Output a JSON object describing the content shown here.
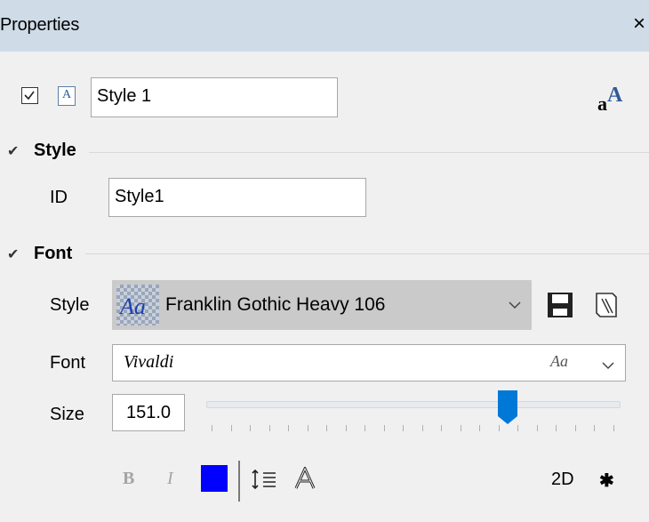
{
  "window": {
    "title": "Properties",
    "close_glyph": "×"
  },
  "header": {
    "enabled": true,
    "checkbox_icon": "checkbox-checked-icon",
    "doc_icon_glyph": "A",
    "style_name_value": "Style 1",
    "font_settings_icon": "font-size-icon"
  },
  "sections": {
    "style": {
      "label": "Style",
      "id_label": "ID",
      "id_value": "Style1"
    },
    "font": {
      "label": "Font",
      "style_label": "Style",
      "style_value": "Franklin Gothic Heavy 106",
      "font_label": "Font",
      "font_value": "Vivaldi",
      "size_label": "Size",
      "size_value": "151.0",
      "size_slider_fraction": 0.73
    }
  },
  "toolbar": {
    "bold_label": "B",
    "italic_label": "I",
    "color": "#0000ff",
    "mode_label": "2D"
  },
  "colors": {
    "accent": "#0078d7",
    "titlebar": "#cfdbe7"
  }
}
